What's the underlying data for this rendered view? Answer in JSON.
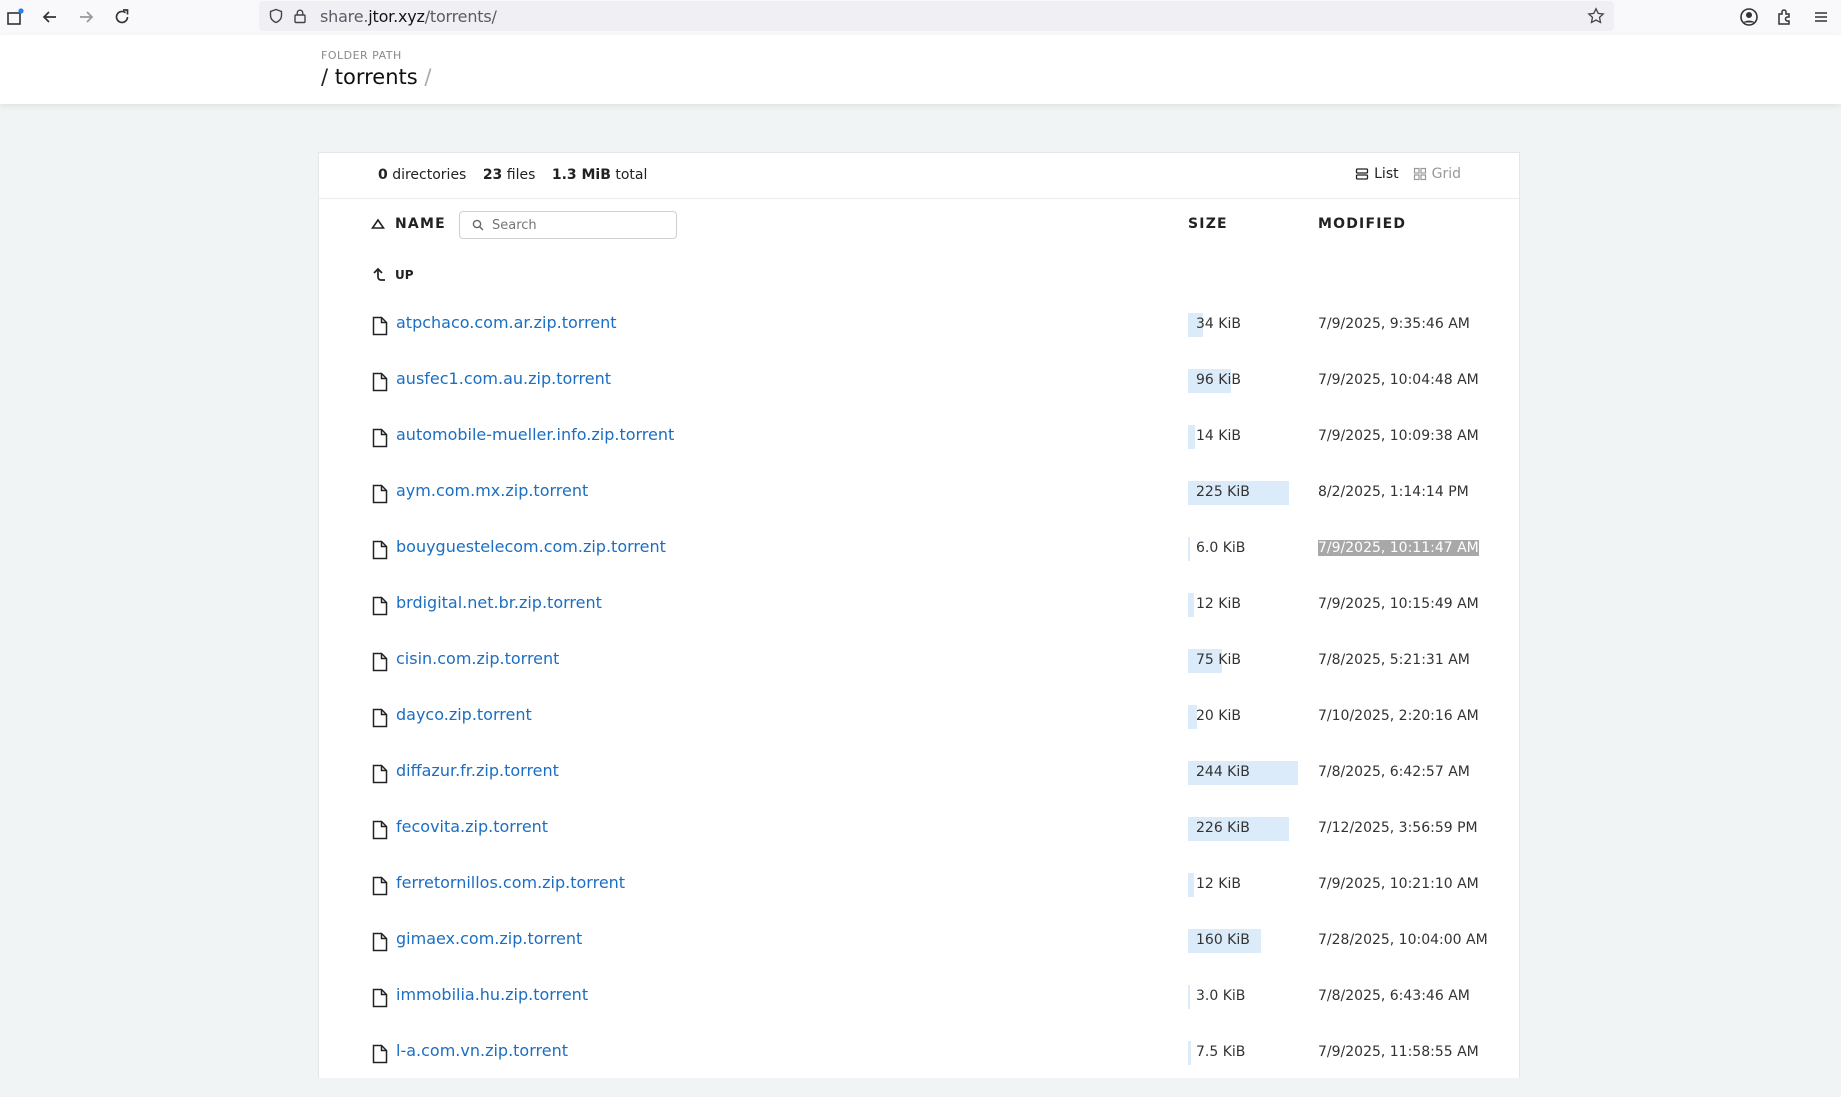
{
  "browser": {
    "url_prefix": "share.",
    "url_domain": "jtor.xyz",
    "url_path": "/torrents/"
  },
  "header": {
    "folder_path_label": "FOLDER PATH",
    "root_sep": "/",
    "folder": "torrents",
    "trail_sep": "/"
  },
  "summary": {
    "directories_count": "0",
    "directories_label": "directories",
    "files_count": "23",
    "files_label": "files",
    "total_size": "1.3 MiB",
    "total_label": "total"
  },
  "view": {
    "list_label": "List",
    "grid_label": "Grid",
    "active": "list"
  },
  "columns": {
    "name": "NAME",
    "size": "SIZE",
    "modified": "MODIFIED"
  },
  "search": {
    "placeholder": "Search",
    "value": ""
  },
  "up_label": "UP",
  "files": [
    {
      "name": "atpchaco.com.ar.zip.torrent",
      "size": "34 KiB",
      "size_fraction": 0.14,
      "modified": "7/9/2025, 9:35:46 AM"
    },
    {
      "name": "ausfec1.com.au.zip.torrent",
      "size": "96 KiB",
      "size_fraction": 0.39,
      "modified": "7/9/2025, 10:04:48 AM"
    },
    {
      "name": "automobile-mueller.info.zip.torrent",
      "size": "14 KiB",
      "size_fraction": 0.06,
      "modified": "7/9/2025, 10:09:38 AM"
    },
    {
      "name": "aym.com.mx.zip.torrent",
      "size": "225 KiB",
      "size_fraction": 0.92,
      "modified": "8/2/2025, 1:14:14 PM"
    },
    {
      "name": "bouyguestelecom.com.zip.torrent",
      "size": "6.0 KiB",
      "size_fraction": 0.02,
      "modified": "7/9/2025, 10:11:47 AM",
      "selected": true
    },
    {
      "name": "brdigital.net.br.zip.torrent",
      "size": "12 KiB",
      "size_fraction": 0.05,
      "modified": "7/9/2025, 10:15:49 AM"
    },
    {
      "name": "cisin.com.zip.torrent",
      "size": "75 KiB",
      "size_fraction": 0.31,
      "modified": "7/8/2025, 5:21:31 AM"
    },
    {
      "name": "dayco.zip.torrent",
      "size": "20 KiB",
      "size_fraction": 0.08,
      "modified": "7/10/2025, 2:20:16 AM"
    },
    {
      "name": "diffazur.fr.zip.torrent",
      "size": "244 KiB",
      "size_fraction": 1.0,
      "modified": "7/8/2025, 6:42:57 AM"
    },
    {
      "name": "fecovita.zip.torrent",
      "size": "226 KiB",
      "size_fraction": 0.92,
      "modified": "7/12/2025, 3:56:59 PM"
    },
    {
      "name": "ferretornillos.com.zip.torrent",
      "size": "12 KiB",
      "size_fraction": 0.05,
      "modified": "7/9/2025, 10:21:10 AM"
    },
    {
      "name": "gimaex.com.zip.torrent",
      "size": "160 KiB",
      "size_fraction": 0.66,
      "modified": "7/28/2025, 10:04:00 AM"
    },
    {
      "name": "immobilia.hu.zip.torrent",
      "size": "3.0 KiB",
      "size_fraction": 0.01,
      "modified": "7/8/2025, 6:43:46 AM"
    },
    {
      "name": "l-a.com.vn.zip.torrent",
      "size": "7.5 KiB",
      "size_fraction": 0.03,
      "modified": "7/9/2025, 11:58:55 AM"
    }
  ],
  "colors": {
    "link": "#1b6ec2",
    "size_bar": "#dcebfa",
    "page_bg": "#f1f4f4",
    "selection": "#a8a8a8"
  }
}
